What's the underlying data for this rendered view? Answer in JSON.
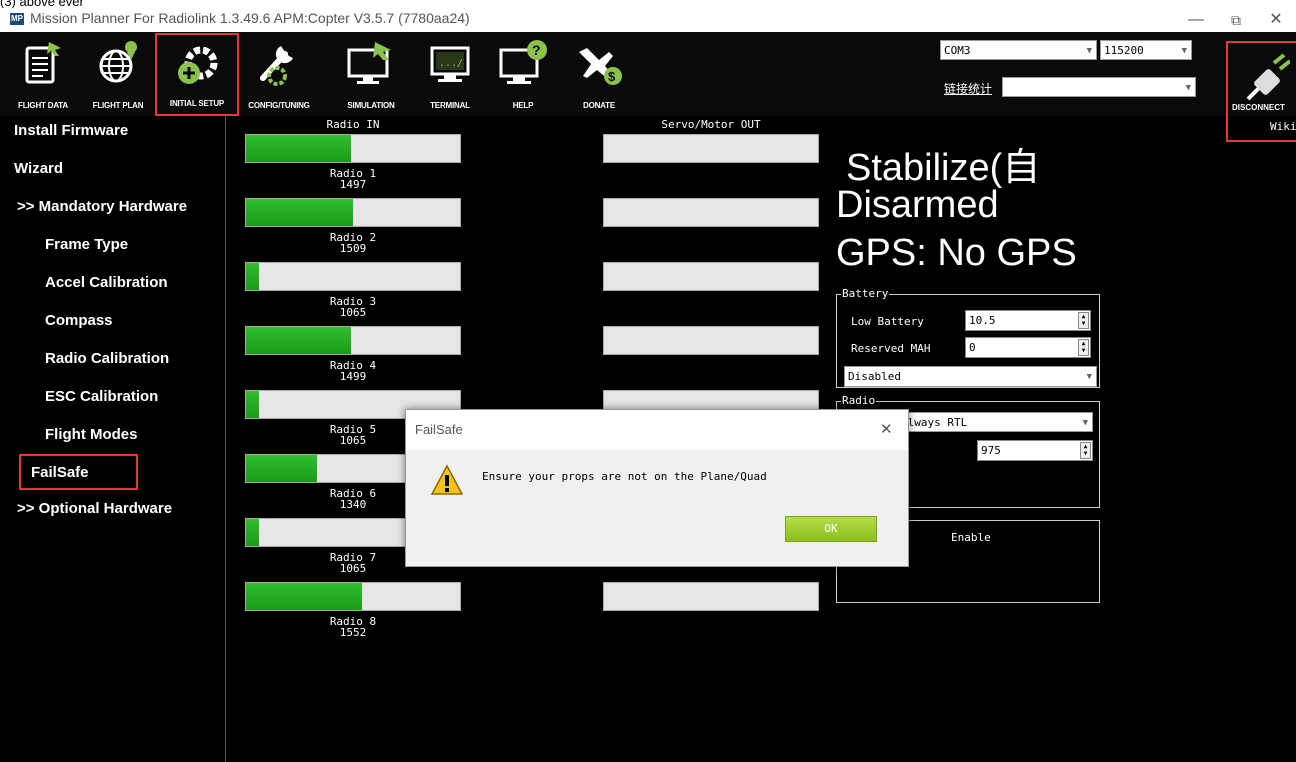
{
  "caption_fragment": "(3) above ever",
  "window": {
    "title": "Mission Planner For Radiolink 1.3.49.6 APM:Copter V3.5.7 (7780aa24)",
    "app_icon": "MP",
    "minimize_icon": "—",
    "restore_icon": "⧉",
    "close_icon": "✕"
  },
  "toolbar": {
    "items": [
      {
        "label": "FLIGHT DATA",
        "icon": "clipboard-icon"
      },
      {
        "label": "FLIGHT PLAN",
        "icon": "globe-icon"
      },
      {
        "label": "INITIAL SETUP",
        "icon": "setup-gear-icon"
      },
      {
        "label": "CONFIG/TUNING",
        "icon": "wrench-icon"
      },
      {
        "label": "SIMULATION",
        "icon": "monitor-plane-icon"
      },
      {
        "label": "TERMINAL",
        "icon": "terminal-icon"
      },
      {
        "label": "HELP",
        "icon": "help-monitor-icon"
      },
      {
        "label": "DONATE",
        "icon": "plane-dollar-icon"
      }
    ],
    "port_select": "COM3",
    "baud_select": "115200",
    "link_stats": "链接统计",
    "disconnect_label": "DISCONNECT",
    "wiki_label": "Wiki"
  },
  "sidebar": {
    "items": [
      "Install Firmware",
      "Wizard",
      ">> Mandatory Hardware",
      "Frame Type",
      "Accel Calibration",
      "Compass",
      "Radio Calibration",
      "ESC Calibration",
      "Flight Modes",
      "FailSafe",
      ">> Optional Hardware"
    ]
  },
  "radio": {
    "header_in": "Radio IN",
    "header_out": "Servo/Motor OUT",
    "channels": [
      {
        "name": "Radio 1",
        "value": "1497",
        "fill": 0.49
      },
      {
        "name": "Radio 2",
        "value": "1509",
        "fill": 0.5
      },
      {
        "name": "Radio 3",
        "value": "1065",
        "fill": 0.06
      },
      {
        "name": "Radio 4",
        "value": "1499",
        "fill": 0.49
      },
      {
        "name": "Radio 5",
        "value": "1065",
        "fill": 0.06
      },
      {
        "name": "Radio 6",
        "value": "1340",
        "fill": 0.33
      },
      {
        "name": "Radio 7",
        "value": "1065",
        "fill": 0.06
      },
      {
        "name": "Radio 8",
        "value": "1552",
        "fill": 0.54
      }
    ]
  },
  "status": {
    "mode": "Stabilize(自",
    "armed": "Disarmed",
    "gps": "GPS: No GPS"
  },
  "battery": {
    "legend": "Battery",
    "low_label": "Low Battery",
    "low_value": "10.5",
    "reserved_label": "Reserved MAH",
    "reserved_value": "0",
    "action": "Disabled"
  },
  "radio_fs": {
    "legend": "Radio",
    "action": "always RTL",
    "pwm": "975"
  },
  "gcs_fs": {
    "label": "Enable"
  },
  "dialog": {
    "title": "FailSafe",
    "close": "✕",
    "message": "Ensure your props are not on the Plane/Quad",
    "ok": "OK"
  }
}
